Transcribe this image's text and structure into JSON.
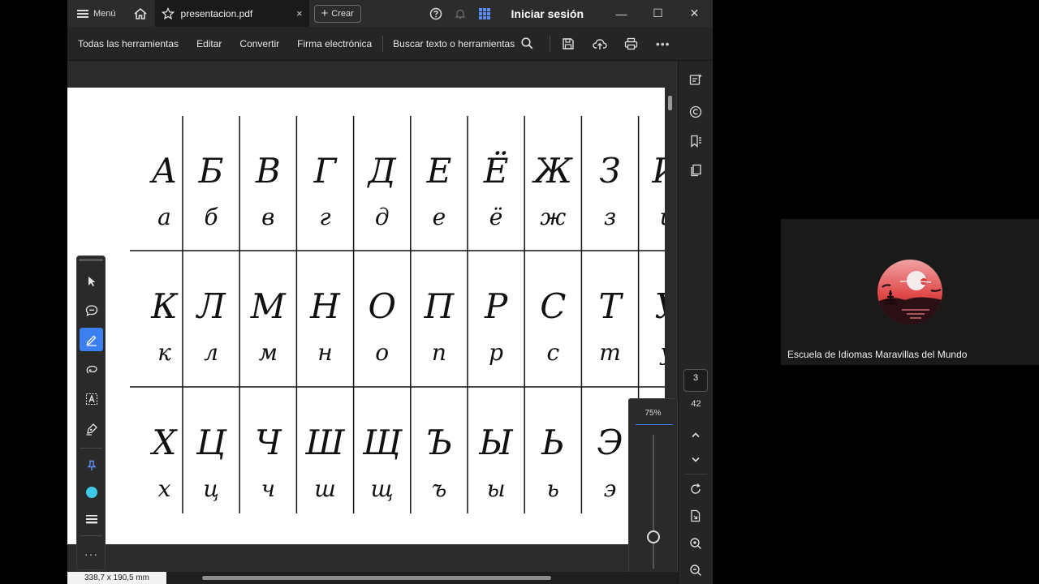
{
  "titlebar": {
    "menu_label": "Menú",
    "tab_title": "presentacion.pdf",
    "tab_close": "×",
    "create_label": "Crear",
    "create_plus": "+",
    "signin_label": "Iniciar sesión",
    "minimize": "—",
    "maximize": "☐",
    "close": "✕"
  },
  "toolbar": {
    "items": [
      "Todas las herramientas",
      "Editar",
      "Convertir",
      "Firma electrónica"
    ],
    "search_label": "Buscar texto o herramientas",
    "more": "•••"
  },
  "document": {
    "rows": [
      {
        "upper": [
          "А",
          "Б",
          "В",
          "Г",
          "Д",
          "Е",
          "Ё",
          "Ж",
          "З",
          "И"
        ],
        "lower": [
          "а",
          "б",
          "в",
          "г",
          "д",
          "е",
          "ё",
          "ж",
          "з",
          "и"
        ]
      },
      {
        "upper": [
          "К",
          "Л",
          "М",
          "Н",
          "О",
          "П",
          "Р",
          "С",
          "Т",
          "У"
        ],
        "lower": [
          "к",
          "л",
          "м",
          "н",
          "о",
          "п",
          "р",
          "с",
          "т",
          "у"
        ]
      },
      {
        "upper": [
          "Х",
          "Ц",
          "Ч",
          "Ш",
          "Щ",
          "Ъ",
          "Ы",
          "Ь",
          "Э",
          ""
        ],
        "lower": [
          "х",
          "ц",
          "ч",
          "ш",
          "щ",
          "ъ",
          "ы",
          "ь",
          "э",
          ""
        ]
      }
    ]
  },
  "floating_tools": {
    "more": "···",
    "active_tool": "highlight",
    "color": "#3fc8e8"
  },
  "zoom": {
    "label": "75%",
    "level": 0.75
  },
  "status": {
    "dimensions": "338,7 x 190,5 mm"
  },
  "pagination": {
    "current": "3",
    "total": "42"
  },
  "participant": {
    "name": "Escuela de Idiomas Maravillas del Mundo"
  },
  "colors": {
    "accent": "#3b7ff0",
    "highlight": "#3fc8e8"
  }
}
